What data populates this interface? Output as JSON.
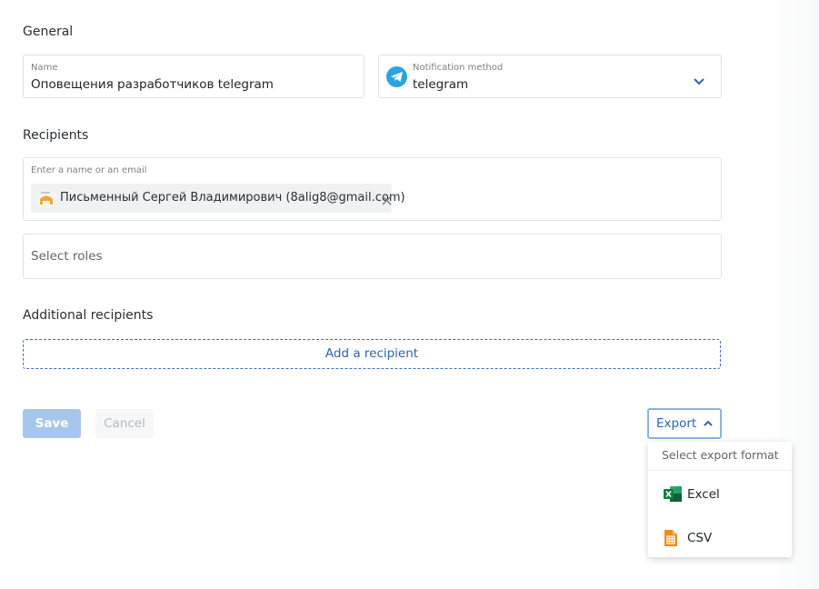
{
  "general": {
    "title": "General",
    "name_field": {
      "label": "Name",
      "value": "Оповещения разработчиков telegram"
    },
    "notification_field": {
      "label": "Notification method",
      "value": "telegram",
      "icon": "telegram-icon",
      "icon_color": "#2aa3e0"
    }
  },
  "recipients": {
    "title": "Recipients",
    "search_placeholder": "Enter a name or an email",
    "chips": [
      {
        "label": "Письменный Сергей Владимирович (8alig8@gmail.com)",
        "icon": "avatar"
      }
    ],
    "roles_placeholder": "Select roles"
  },
  "additional": {
    "title": "Additional recipients",
    "add_label": "Add a recipient"
  },
  "actions": {
    "save_label": "Save",
    "cancel_label": "Cancel",
    "export_label": "Export"
  },
  "export_menu": {
    "header": "Select export format",
    "items": [
      {
        "label": "Excel",
        "icon": "excel-icon",
        "color": "#1e7145"
      },
      {
        "label": "CSV",
        "icon": "csv-icon",
        "color": "#f08a1c"
      }
    ]
  },
  "colors": {
    "accent": "#2d63ad",
    "save_disabled": "#a8c6ec"
  }
}
